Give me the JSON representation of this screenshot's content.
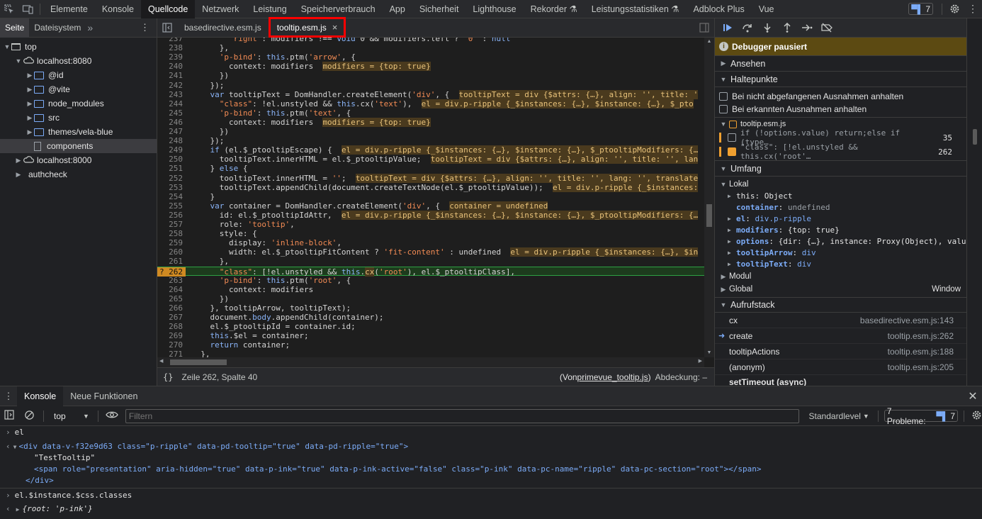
{
  "topbar": {
    "tabs": [
      "Elemente",
      "Konsole",
      "Quellcode",
      "Netzwerk",
      "Leistung",
      "Speicherverbrauch",
      "App",
      "Sicherheit",
      "Lighthouse",
      "Rekorder ⚗",
      "Leistungsstatistiken ⚗",
      "Adblock Plus",
      "Vue"
    ],
    "active_tab": "Quellcode",
    "issues_count": "7"
  },
  "navigator": {
    "tabs": [
      "Seite",
      "Dateisystem"
    ],
    "tree": [
      {
        "label": "top",
        "type": "frame",
        "depth": 0,
        "expanded": true
      },
      {
        "label": "localhost:8080",
        "type": "cloud",
        "depth": 1,
        "expanded": true
      },
      {
        "label": "@id",
        "type": "folder",
        "depth": 2
      },
      {
        "label": "@vite",
        "type": "folder",
        "depth": 2
      },
      {
        "label": "node_modules",
        "type": "folder",
        "depth": 2
      },
      {
        "label": "src",
        "type": "folder",
        "depth": 2
      },
      {
        "label": "themes/vela-blue",
        "type": "folder",
        "depth": 2
      },
      {
        "label": "components",
        "type": "file",
        "depth": 2,
        "selected": true
      },
      {
        "label": "localhost:8000",
        "type": "cloud",
        "depth": 1
      },
      {
        "label": "authcheck",
        "type": "folder-plain",
        "depth": 1
      }
    ]
  },
  "editor": {
    "tabs": [
      {
        "label": "basedirective.esm.js"
      },
      {
        "label": "tooltip.esm.js",
        "active": true,
        "close": "×"
      }
    ],
    "status": {
      "position": "Zeile 262, Spalte 40",
      "source_prefix": "(Von ",
      "source_link": "primevue_tooltip.js",
      "source_suffix": ")",
      "coverage": "Abdeckung: –"
    },
    "lines": [
      {
        "n": "237",
        "html": "        <span class='st'>'right'</span>: modifiers !== <span class='kw'>void</span> 0 && modifiers.left ? <span class='st'>'0'</span> : <span class='kw'>null</span>"
      },
      {
        "n": "238",
        "html": "      },"
      },
      {
        "n": "239",
        "html": "      <span class='st'>'p-bind'</span>: <span class='kw'>this</span>.ptm(<span class='st'>'arrow'</span>, {"
      },
      {
        "n": "240",
        "html": "        context: modifiers  <span class='inl'>modifiers = {top: true}</span>"
      },
      {
        "n": "241",
        "html": "      })"
      },
      {
        "n": "242",
        "html": "    });"
      },
      {
        "n": "243",
        "html": "    <span class='kw'>var</span> tooltipText = DomHandler.createElement(<span class='st'>'div'</span>, {  <span class='inl'>tooltipText = div {$attrs: {…}, align: '', title: '</span>"
      },
      {
        "n": "244",
        "html": "      <span class='st'>\"class\"</span>: !el.unstyled && <span class='kw'>this</span>.cx(<span class='st'>'text'</span>),  <span class='inl'>el = div.p-ripple {_$instances: {…}, $instance: {…}, $_pto</span>"
      },
      {
        "n": "245",
        "html": "      <span class='st'>'p-bind'</span>: <span class='kw'>this</span>.ptm(<span class='st'>'text'</span>, {"
      },
      {
        "n": "246",
        "html": "        context: modifiers  <span class='inl'>modifiers = {top: true}</span>"
      },
      {
        "n": "247",
        "html": "      })"
      },
      {
        "n": "248",
        "html": "    });"
      },
      {
        "n": "249",
        "html": "    <span class='kw'>if</span> (el.$_ptooltipEscape) {  <span class='inl'>el = div.p-ripple {_$instances: {…}, $instance: {…}, $_ptooltipModifiers: {…</span>"
      },
      {
        "n": "250",
        "html": "      tooltipText.innerHTML = el.$_ptooltipValue;  <span class='inl'>tooltipText = div {$attrs: {…}, align: '', title: '', lan</span>"
      },
      {
        "n": "251",
        "html": "    } <span class='kw'>else</span> {"
      },
      {
        "n": "252",
        "html": "      tooltipText.innerHTML = <span class='st'>''</span>;  <span class='inl'>tooltipText = div {$attrs: {…}, align: '', title: '', lang: '', translate</span>"
      },
      {
        "n": "253",
        "html": "      tooltipText.appendChild(document.createTextNode(el.$_ptooltipValue));  <span class='inl'>el = div.p-ripple {_$instances:</span>"
      },
      {
        "n": "254",
        "html": "    }"
      },
      {
        "n": "255",
        "html": "    <span class='kw'>var</span> container = DomHandler.createElement(<span class='st'>'div'</span>, {  <span class='inl'>container = undefined</span>"
      },
      {
        "n": "256",
        "html": "      id: el.$_ptooltipIdAttr,  <span class='inl'>el = div.p-ripple {_$instances: {…}, $instance: {…}, $_ptooltipModifiers: {…</span>"
      },
      {
        "n": "257",
        "html": "      role: <span class='st'>'tooltip'</span>,"
      },
      {
        "n": "258",
        "html": "      style: {"
      },
      {
        "n": "259",
        "html": "        display: <span class='st'>'inline-block'</span>,"
      },
      {
        "n": "260",
        "html": "        width: el.$_ptooltipFitContent ? <span class='st'>'fit-content'</span> : undefined  <span class='inl'>el = div.p-ripple {_$instances: {…}, $in</span>"
      },
      {
        "n": "261",
        "html": "      },"
      },
      {
        "n": "262",
        "html": "      <span class='st'>\"class\"</span>: [!el.unstyled && <span class='kw'>this</span>.<span class='inl'>cx</span>(<span class='st'>'root'</span>), el.$_ptooltipClass],",
        "exec": true,
        "marker": "?"
      },
      {
        "n": "263",
        "html": "      <span class='st'>'p-bind'</span>: <span class='kw'>this</span>.ptm(<span class='st'>'root'</span>, {"
      },
      {
        "n": "264",
        "html": "        context: modifiers"
      },
      {
        "n": "265",
        "html": "      })"
      },
      {
        "n": "266",
        "html": "    }, tooltipArrow, tooltipText);"
      },
      {
        "n": "267",
        "html": "    document.<span class='kw'>body</span>.appendChild(container);"
      },
      {
        "n": "268",
        "html": "    el.$_ptooltipId = container.id;"
      },
      {
        "n": "269",
        "html": "    <span class='kw'>this</span>.$el = container;"
      },
      {
        "n": "270",
        "html": "    <span class='kw'>return</span> container;"
      },
      {
        "n": "271",
        "html": "  },"
      }
    ]
  },
  "debugger": {
    "paused": "Debugger pausiert",
    "sections": {
      "watch": "Ansehen",
      "breakpoints": "Haltepunkte",
      "scope": "Umfang",
      "callstack": "Aufrufstack"
    },
    "pause_options": [
      {
        "label": "Bei nicht abgefangenen Ausnahmen anhalten"
      },
      {
        "label": "Bei erkannten Ausnahmen anhalten"
      }
    ],
    "bp_file": "tooltip.esm.js",
    "breakpoints": [
      {
        "code": "if (!options.value) return;else if (type…",
        "line": "35",
        "checked": false
      },
      {
        "code": "\"class\": [!el.unstyled && this.cx('root'…",
        "line": "262",
        "checked": true
      }
    ],
    "scope": {
      "local_label": "Lokal",
      "vars": [
        {
          "name": "this",
          "sep": ": ",
          "value": "Object",
          "arrow": true,
          "bold": false
        },
        {
          "name": "container",
          "sep": ": ",
          "value": "undefined",
          "arrow": false,
          "bold": true,
          "undef": true
        },
        {
          "name": "el",
          "sep": ": ",
          "value": "div.p-ripple",
          "arrow": true,
          "bold": true,
          "blue": true
        },
        {
          "name": "modifiers",
          "sep": ": ",
          "value": "{top: true}",
          "arrow": true,
          "bold": true
        },
        {
          "name": "options",
          "sep": ": ",
          "value": "{dir: {…}, instance: Proxy(Object), valu",
          "arrow": true,
          "bold": true
        },
        {
          "name": "tooltipArrow",
          "sep": ": ",
          "value": "div",
          "arrow": true,
          "bold": true,
          "blue": true
        },
        {
          "name": "tooltipText",
          "sep": ": ",
          "value": "div",
          "arrow": true,
          "bold": true,
          "blue": true
        }
      ],
      "module_label": "Modul",
      "global_label": "Global",
      "global_value": "Window"
    },
    "callstack": [
      {
        "fn": "cx",
        "loc": "basedirective.esm.js:143"
      },
      {
        "fn": "create",
        "loc": "tooltip.esm.js:262",
        "current": true
      },
      {
        "fn": "tooltipActions",
        "loc": "tooltip.esm.js:188"
      },
      {
        "fn": "(anonym)",
        "loc": "tooltip.esm.js:205"
      }
    ],
    "async_label": "setTimeout (async)"
  },
  "drawer": {
    "tabs": [
      "Konsole",
      "Neue Funktionen"
    ],
    "context": "top",
    "filter_placeholder": "Filtern",
    "level": "Standardlevel",
    "problems_label": "7 Probleme:",
    "problems_count": "7",
    "lines": {
      "input1": "el",
      "dom_open": "<div data-v-f32e9d63 class=\"p-ripple\" data-pd-tooltip=\"true\" data-pd-ripple=\"true\">",
      "text_node": "\"TestTooltip\"",
      "span": "<span role=\"presentation\" aria-hidden=\"true\" data-p-ink=\"true\" data-p-ink-active=\"false\" class=\"p-ink\" data-pc-name=\"ripple\" data-pc-section=\"root\"></span>",
      "dom_close": "</div>",
      "input2": "el.$instance.$css.classes",
      "output2": "{root: 'p-ink'}"
    }
  }
}
